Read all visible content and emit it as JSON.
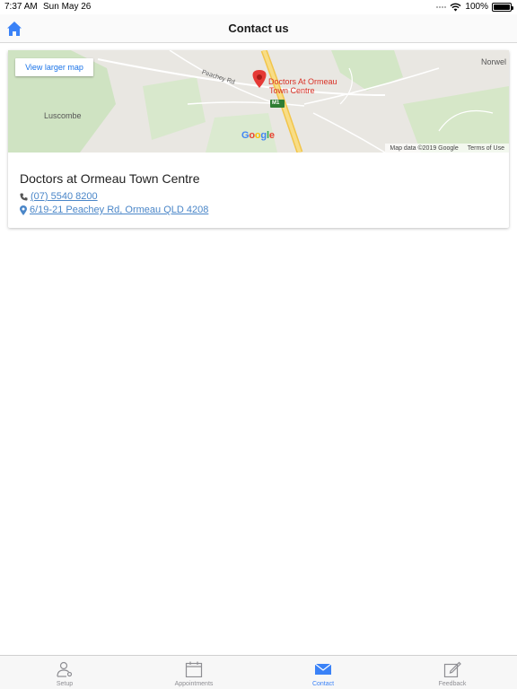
{
  "status": {
    "time": "7:37 AM",
    "date": "Sun May 26",
    "battery": "100%",
    "battery_level": 1.0
  },
  "navbar": {
    "title": "Contact us"
  },
  "map": {
    "view_larger_label": "View larger map",
    "places": {
      "norwell": "Norwel",
      "luscombe": "Luscombe",
      "peachey_rd": "Peachey Rd",
      "marker_line1": "Doctors At Ormeau",
      "marker_line2": "Town Centre",
      "highway": "M1"
    },
    "google_logo": "Google",
    "map_data": "Map data ©2019 Google",
    "terms": "Terms of Use"
  },
  "practice": {
    "name": "Doctors at Ormeau Town Centre",
    "phone": "(07) 5540 8200",
    "address": "6/19-21 Peachey Rd, Ormeau QLD 4208"
  },
  "tabs": [
    {
      "label": "Setup",
      "icon": "person-gear-icon",
      "active": false
    },
    {
      "label": "Appointments",
      "icon": "calendar-icon",
      "active": false
    },
    {
      "label": "Contact",
      "icon": "envelope-icon",
      "active": true
    },
    {
      "label": "Feedback",
      "icon": "compose-icon",
      "active": false
    }
  ],
  "colors": {
    "accent": "#3a82f7",
    "link": "#4a86c8",
    "marker": "#e53935",
    "highway": "#f6d36b"
  }
}
